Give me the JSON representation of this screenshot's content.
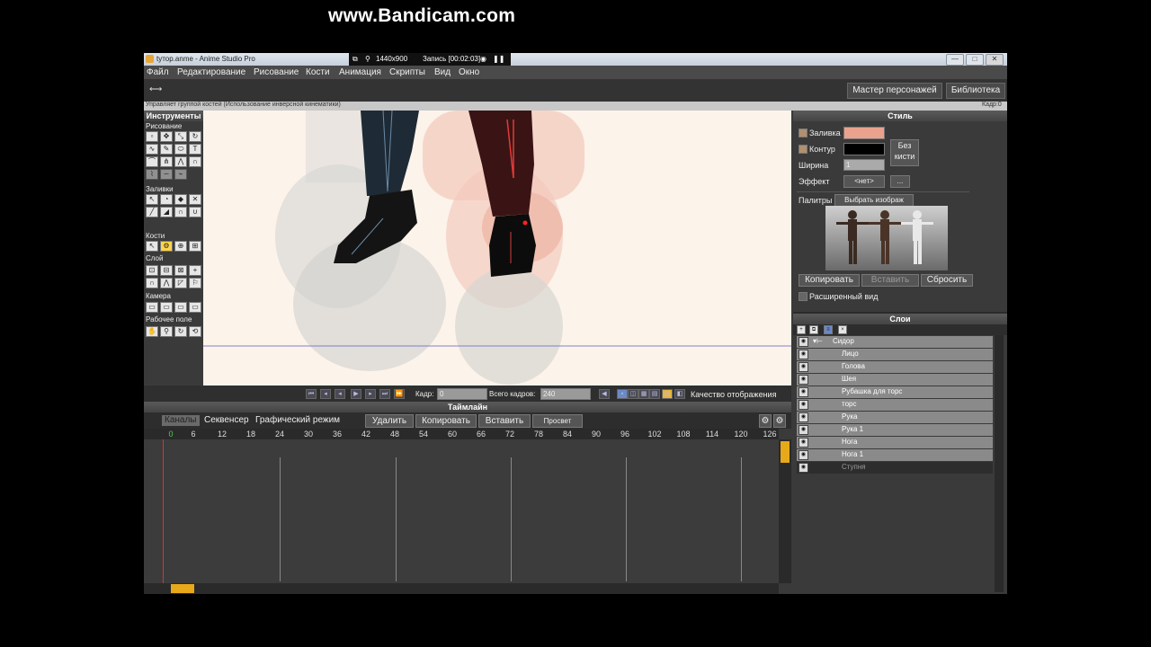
{
  "window": {
    "title": "tyтор.anme - Anime Studio Pro",
    "min": "—",
    "max": "□",
    "close": "✕"
  },
  "bandicam": {
    "resolution": "1440x900",
    "record": "Запись [00:02:03]",
    "watermark": "www.Bandicam.com"
  },
  "menu": [
    "Файл",
    "Редактирование",
    "Рисование",
    "Кости",
    "Анимация",
    "Скрипты",
    "Вид",
    "Окно"
  ],
  "topbar": {
    "wizard": "Мастер персонажей",
    "library": "Библиотека"
  },
  "statusbar": {
    "hint": "Управляет группой костей (Использование инверсной кинематики)",
    "frame": "Кадр:0"
  },
  "tools": {
    "title": "Инструменты",
    "groups": [
      "Рисование",
      "Заливки",
      "Кости",
      "Слой",
      "Камера",
      "Рабочее поле"
    ]
  },
  "playback": {
    "frame_label": "Кадр:",
    "frame_value": "0",
    "total_label": "Всего кадров:",
    "total_value": "240",
    "quality": "Качество отображения"
  },
  "timeline": {
    "title": "Таймлайн",
    "tabs": [
      "Каналы",
      "Секвенсер",
      "Графический режим"
    ],
    "buttons": [
      "Удалить",
      "Копировать",
      "Вставить",
      "Просвет"
    ],
    "ruler": [
      "0",
      "6",
      "12",
      "18",
      "24",
      "30",
      "36",
      "42",
      "48",
      "54",
      "60",
      "66",
      "72",
      "78",
      "84",
      "90",
      "96",
      "102",
      "108",
      "114",
      "120",
      "126"
    ]
  },
  "style": {
    "title": "Стиль",
    "fill_label": "Заливка",
    "outline_label": "Контур",
    "width_label": "Ширина",
    "width_value": "1",
    "no_brush": "Без кисти",
    "effect_label": "Эффект",
    "effect_value": "<нет>",
    "effect_more": "...",
    "palettes_label": "Палитры",
    "palettes_value": "Выбрать изображ",
    "copy": "Копировать",
    "paste": "Вставить",
    "reset": "Сбросить",
    "advanced": "Расширенный вид",
    "fill_color": "#e9a28e",
    "outline_color": "#000000"
  },
  "layers": {
    "title": "Слои",
    "items": [
      "Сидор",
      "Лицо",
      "Голова",
      "Шея",
      "Рубашка для торс",
      "торс",
      "Рука",
      "Рука 1",
      "Нога",
      "Нога 1",
      "Ступня"
    ]
  }
}
